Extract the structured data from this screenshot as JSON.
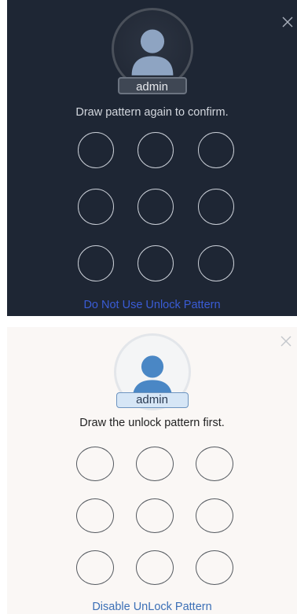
{
  "screen_dark": {
    "username": "admin",
    "prompt": "Draw pattern again to confirm.",
    "link_label": "Do Not Use Unlock Pattern",
    "close_icon": "close-icon",
    "avatar_icon": "user-icon",
    "colors": {
      "background": "#1e2634",
      "link": "#3a5cd6"
    }
  },
  "screen_light": {
    "username": "admin",
    "prompt": "Draw the unlock pattern first.",
    "link_label": "Disable UnLock Pattern",
    "close_icon": "close-icon",
    "avatar_icon": "user-icon",
    "colors": {
      "background": "#faf7f5",
      "link": "#3b6fb6",
      "accent": "#4a87c5"
    }
  },
  "pattern_grid": {
    "rows": 3,
    "cols": 3
  }
}
